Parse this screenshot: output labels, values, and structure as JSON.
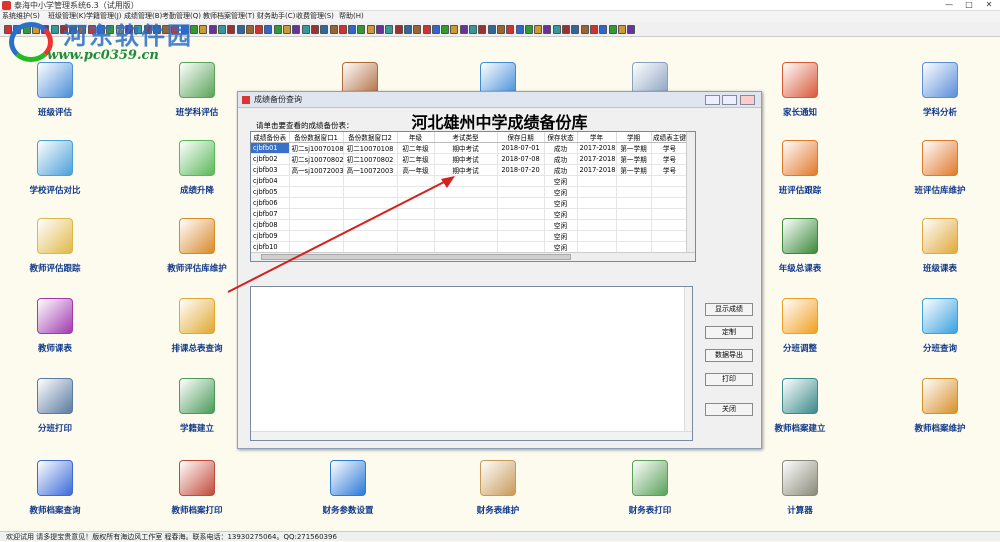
{
  "app": {
    "title": "泰海中小学管理系统6.3（试用版）",
    "controls": [
      "—",
      "□",
      "✕"
    ]
  },
  "menu": [
    "系统维护(S)",
    "班级管理(K)",
    "学籍管理(J)",
    "成绩管理(B)",
    "考勤管理(Q)",
    "教师档案管理(T)",
    "财务助手(C)",
    "收费管理(S)",
    "帮助(H)"
  ],
  "watermark": {
    "text": "河东软件园",
    "url": "www.pc0359.cn"
  },
  "tiles": [
    {
      "label": "班级评估",
      "color": "#4a8ed8"
    },
    {
      "label": "班学科评估",
      "color": "#5aa35a"
    },
    {
      "label": "",
      "color": "#b06a3a"
    },
    {
      "label": "",
      "color": "#3f8bd8"
    },
    {
      "label": "",
      "color": "#8aa0c0"
    },
    {
      "label": "家长通知",
      "color": "#d75a3a"
    },
    {
      "label": "学科分析",
      "color": "#5a8ed8"
    },
    {
      "label": "学校评估对比",
      "color": "#4aa0d8"
    },
    {
      "label": "成绩升降",
      "color": "#5ab85a"
    },
    {
      "label": "班评估跟踪",
      "color": "#e07a2a"
    },
    {
      "label": "班评估库维护",
      "color": "#e07a2a"
    },
    {
      "label": "教师评估跟踪",
      "color": "#e0b84a"
    },
    {
      "label": "教师评估库维护",
      "color": "#d88a2a"
    },
    {
      "label": "年级总课表",
      "color": "#3a8a3a"
    },
    {
      "label": "班级课表",
      "color": "#e0a83a"
    },
    {
      "label": "教师课表",
      "color": "#a03ab0"
    },
    {
      "label": "排课总表查询",
      "color": "#e0a830"
    },
    {
      "label": "分班调整",
      "color": "#f0a020"
    },
    {
      "label": "分班查询",
      "color": "#3aa0e0"
    },
    {
      "label": "分班打印",
      "color": "#5a7aa0"
    },
    {
      "label": "学籍建立",
      "color": "#4a9a5a"
    },
    {
      "label": "教师档案建立",
      "color": "#3a8a8a"
    },
    {
      "label": "教师档案维护",
      "color": "#d8902a"
    },
    {
      "label": "教师档案查询",
      "color": "#3a6ad8"
    },
    {
      "label": "教师档案打印",
      "color": "#c04a3a"
    },
    {
      "label": "财务参数设置",
      "color": "#2a7ad8"
    },
    {
      "label": "财务表维护",
      "color": "#c89a5a"
    },
    {
      "label": "财务表打印",
      "color": "#5aa05a"
    },
    {
      "label": "计算器",
      "color": "#8a8a7a"
    }
  ],
  "dialog": {
    "title": "成绩备份查询",
    "heading": "河北雄州中学成绩备份库",
    "prompt": "请单击要查看的成绩备份表：",
    "columns": [
      "成绩备份表",
      "备份数据窗口1",
      "备份数据窗口2",
      "年级",
      "考试类型",
      "保存日期",
      "保存状态",
      "学年",
      "学期",
      "成绩表主键"
    ],
    "rows": [
      [
        "cjbfb01",
        "初二sj10070108",
        "初二10070108",
        "初二年级",
        "期中考试",
        "2018-07-01",
        "成功",
        "2017-2018",
        "第一学期",
        "学号"
      ],
      [
        "cjbfb02",
        "初二sj10070802",
        "初二10070802",
        "初二年级",
        "期中考试",
        "2018-07-08",
        "成功",
        "2017-2018",
        "第一学期",
        "学号"
      ],
      [
        "cjbfb03",
        "高一sj10072003",
        "高一10072003",
        "高一年级",
        "期中考试",
        "2018-07-20",
        "成功",
        "2017-2018",
        "第一学期",
        "学号"
      ],
      [
        "cjbfb04",
        "",
        "",
        "",
        "",
        "",
        "空闲",
        "",
        "",
        ""
      ],
      [
        "cjbfb05",
        "",
        "",
        "",
        "",
        "",
        "空闲",
        "",
        "",
        ""
      ],
      [
        "cjbfb06",
        "",
        "",
        "",
        "",
        "",
        "空闲",
        "",
        "",
        ""
      ],
      [
        "cjbfb07",
        "",
        "",
        "",
        "",
        "",
        "空闲",
        "",
        "",
        ""
      ],
      [
        "cjbfb08",
        "",
        "",
        "",
        "",
        "",
        "空闲",
        "",
        "",
        ""
      ],
      [
        "cjbfb09",
        "",
        "",
        "",
        "",
        "",
        "空闲",
        "",
        "",
        ""
      ],
      [
        "cjbfb10",
        "",
        "",
        "",
        "",
        "",
        "空闲",
        "",
        "",
        ""
      ]
    ],
    "buttons": {
      "show": "显示成绩",
      "custom": "定制",
      "export": "数据导出",
      "print": "打印",
      "close": "关闭"
    }
  },
  "status": "欢迎试用 请多提宝贵意见！版权所有海边风工作室 程春海。联系电话：13930275064。QQ:271560396"
}
